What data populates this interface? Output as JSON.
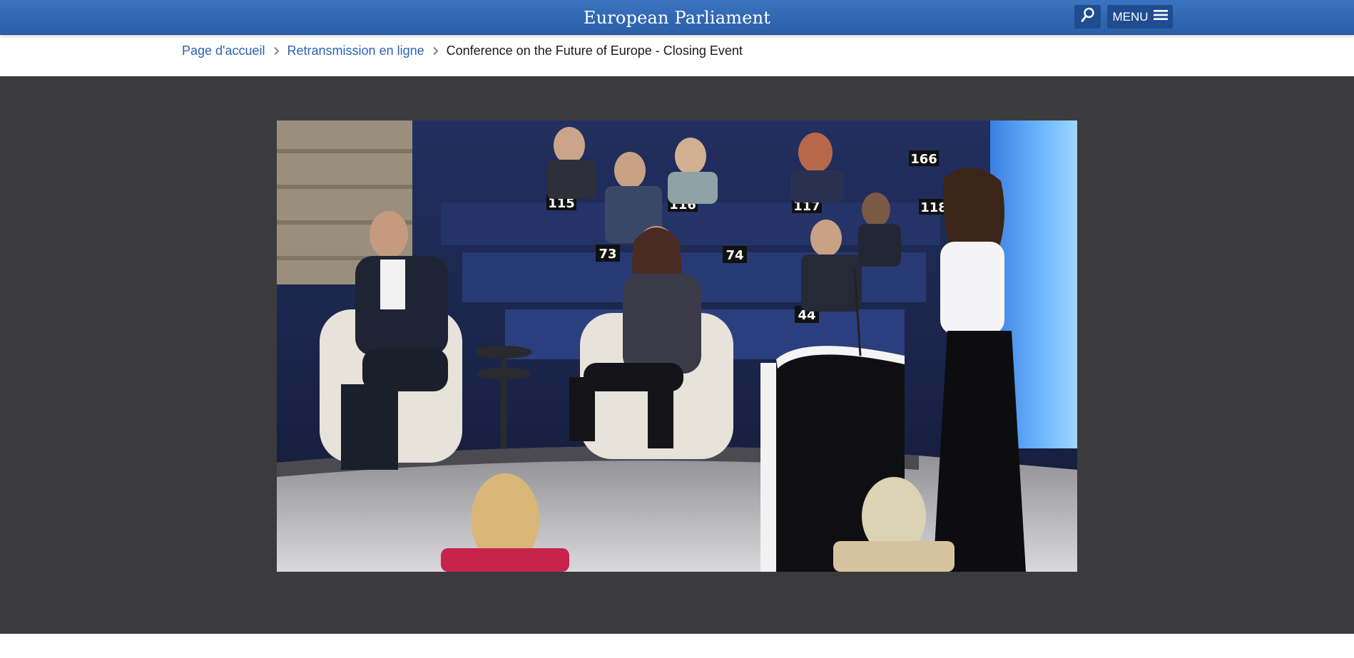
{
  "header": {
    "brand": "European Parliament",
    "search_icon": "search-icon",
    "menu_label": "MENU",
    "menu_icon": "hamburger-icon",
    "bar_color": "#3a74c0"
  },
  "breadcrumb": {
    "items": [
      {
        "label": "Page d'accueil"
      },
      {
        "label": "Retransmission en ligne"
      }
    ],
    "current": "Conference on the Future of Europe - Closing Event",
    "separator_icon": "chevron-right-icon",
    "link_color": "#2b63b0"
  },
  "video": {
    "seat_numbers": [
      "166",
      "115",
      "116",
      "117",
      "118",
      "73",
      "74",
      "44"
    ]
  },
  "stage": {
    "background": "#3b3b3e"
  }
}
